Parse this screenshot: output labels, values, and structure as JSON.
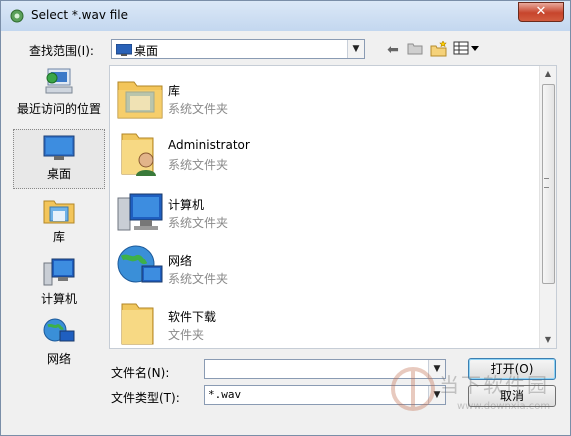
{
  "window": {
    "title": "Select *.wav file",
    "close_glyph": "✕"
  },
  "toolbar": {
    "lookin_label": "查找范围(I):",
    "lookin_value": "桌面",
    "icons": [
      "back-arrow-icon",
      "up-folder-icon",
      "new-folder-icon",
      "view-menu-icon"
    ]
  },
  "places": [
    {
      "label": "最近访问的位置",
      "icon": "recent-places-icon"
    },
    {
      "label": "桌面",
      "icon": "desktop-icon",
      "selected": true
    },
    {
      "label": "库",
      "icon": "libraries-icon"
    },
    {
      "label": "计算机",
      "icon": "computer-icon"
    },
    {
      "label": "网络",
      "icon": "network-icon"
    }
  ],
  "files": [
    {
      "name": "库",
      "type": "系统文件夹",
      "icon": "libraries-icon"
    },
    {
      "name": "Administrator",
      "type": "系统文件夹",
      "icon": "user-folder-icon"
    },
    {
      "name": "计算机",
      "type": "系统文件夹",
      "icon": "computer-icon"
    },
    {
      "name": "网络",
      "type": "系统文件夹",
      "icon": "network-icon"
    },
    {
      "name": "软件下载",
      "type": "文件夹",
      "icon": "folder-icon"
    }
  ],
  "bottom": {
    "filename_label": "文件名(N):",
    "filename_value": "",
    "filetype_label": "文件类型(T):",
    "filetype_value": "*.wav",
    "open_label": "打开(O)",
    "cancel_label": "取消"
  },
  "watermark": {
    "text": "当下软件园",
    "url": "www.downxia.com"
  }
}
